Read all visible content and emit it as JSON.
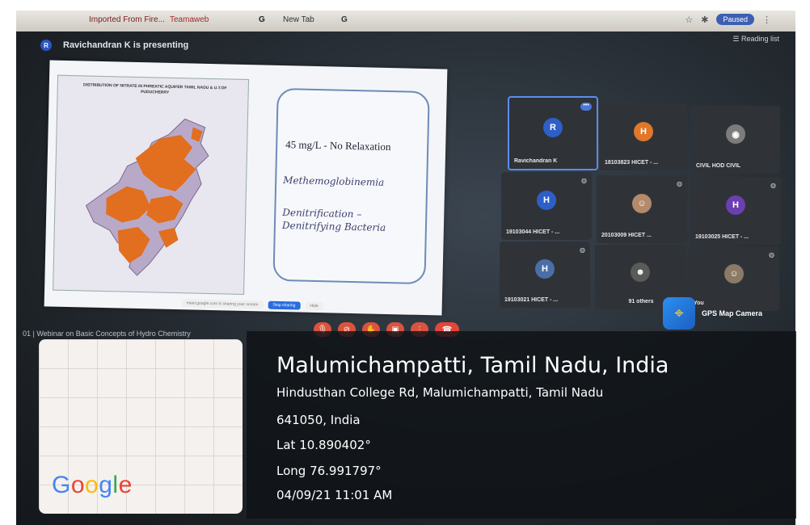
{
  "browser": {
    "bookmarks": [
      "Imported From Fire...",
      "Teamaweb",
      "G",
      "New Tab",
      "G"
    ],
    "paused_label": "Paused",
    "reading_list": "Reading list"
  },
  "meet": {
    "presenting_banner": "Ravichandran K is presenting",
    "meeting_title": "01  |  Webinar on Basic Concepts of Hydro Chemistry",
    "slide": {
      "map_title": "DISTRIBUTION OF NITRATE IN PHREATIC AQUIFER TAMIL NADU & U.T.OF PUDUCHERRY",
      "line1": "45 mg/L  - No Relaxation",
      "line2": "Methemoglobinemia",
      "line3": "Denitrification –",
      "line4": "Denitrifying Bacteria"
    },
    "share_bar": {
      "message": "meet.google.com is sharing your screen",
      "stop": "Stop sharing",
      "hide": "Hide"
    },
    "participants": [
      {
        "initial": "R",
        "name": "Ravichandran K",
        "color": "#2e5fc8"
      },
      {
        "initial": "H",
        "name": "18103823 HICET - ...",
        "color": "#e0772a"
      },
      {
        "initial": "",
        "name": "CIVIL HOD CIVIL",
        "color": "#7c7c7c"
      },
      {
        "initial": "H",
        "name": "19103044 HICET - ...",
        "color": "#2e5fc8"
      },
      {
        "initial": "",
        "name": "20103009 HICET ...",
        "color": "#b48a6b"
      },
      {
        "initial": "H",
        "name": "19103025 HICET - ...",
        "color": "#6b3fb0"
      },
      {
        "initial": "H",
        "name": "19103021 HICET - ...",
        "color": "#4a6fa8"
      },
      {
        "initial": "",
        "name": "91 others",
        "color": "#5a5a5a"
      },
      {
        "initial": "",
        "name": "You",
        "color": "#8a7a66"
      }
    ]
  },
  "gps": {
    "app_name": "GPS Map Camera",
    "map_brand": "Google",
    "place": "Malumichampatti, Tamil Nadu, India",
    "address": "Hindusthan College Rd, Malumichampatti, Tamil Nadu",
    "postal": "641050, India",
    "lat": "Lat 10.890402°",
    "long": "Long 76.991797°",
    "datetime": "04/09/21 11:01 AM"
  }
}
